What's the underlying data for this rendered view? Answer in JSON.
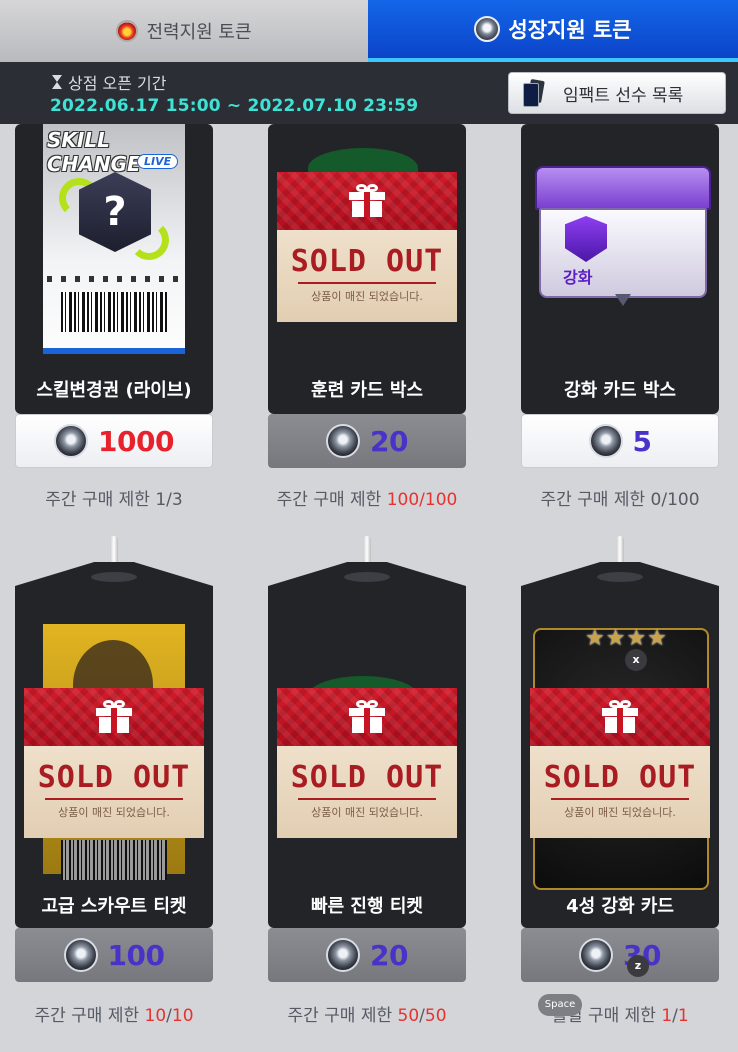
{
  "tabs": [
    {
      "label": "전력지원 토큰",
      "icon": "fire-token-icon",
      "active": false
    },
    {
      "label": "성장지원 토큰",
      "icon": "growth-token-icon",
      "active": true
    }
  ],
  "shop": {
    "period_label": "상점 오픈 기간",
    "period_value": "2022.06.17 15:00 ~ 2022.07.10 23:59",
    "impact_button": "임팩트 선수 목록"
  },
  "items": [
    {
      "name": "스킬변경권 (라이브)",
      "price": "1000",
      "limit_prefix": "주간 구매 제한 ",
      "limit_cur": "1",
      "limit_sep": "/",
      "limit_max": "3",
      "limit_highlight": false,
      "sold_out": false,
      "price_style": "red"
    },
    {
      "name": "훈련 카드 박스",
      "price": "20",
      "limit_prefix": "주간 구매 제한 ",
      "limit_cur": "100",
      "limit_sep": "/",
      "limit_max": "100",
      "limit_highlight": true,
      "sold_out": true,
      "price_style": "blue"
    },
    {
      "name": "강화 카드 박스",
      "price": "5",
      "limit_prefix": "주간 구매 제한 ",
      "limit_cur": "0",
      "limit_sep": "/",
      "limit_max": "100",
      "limit_highlight": false,
      "sold_out": false,
      "price_style": "blue"
    },
    {
      "name": "고급 스카우트 티켓",
      "price": "100",
      "limit_prefix": "주간 구매 제한 ",
      "limit_cur": "10",
      "limit_sep": "/",
      "limit_max": "10",
      "limit_highlight": true,
      "sold_out": true,
      "price_style": "blue"
    },
    {
      "name": "빠른 진행 티켓",
      "price": "20",
      "limit_prefix": "주간 구매 제한 ",
      "limit_cur": "50",
      "limit_sep": "/",
      "limit_max": "50",
      "limit_highlight": true,
      "sold_out": true,
      "price_style": "blue"
    },
    {
      "name": "4성 강화 카드",
      "price": "30",
      "limit_prefix": "월별 구매 제한 ",
      "limit_cur": "1",
      "limit_sep": "/",
      "limit_max": "1",
      "limit_highlight": true,
      "sold_out": true,
      "price_style": "blue"
    }
  ],
  "sold_out": {
    "title": "SOLD OUT",
    "subtitle": "상품이 매진 되었습니다."
  },
  "art": {
    "skill_ticket_title": "SKILL CHANGE",
    "skill_ticket_badge": "LIVE",
    "skill_ticket_mark": "?",
    "reinforce_label": "강화",
    "stars": "★★★★"
  },
  "overlay_keys": {
    "x": "x",
    "z": "z",
    "space": "Space"
  },
  "colors": {
    "active_tab": "#0b44c9",
    "highlight": "#e8322f",
    "period": "#3fe3d6"
  }
}
